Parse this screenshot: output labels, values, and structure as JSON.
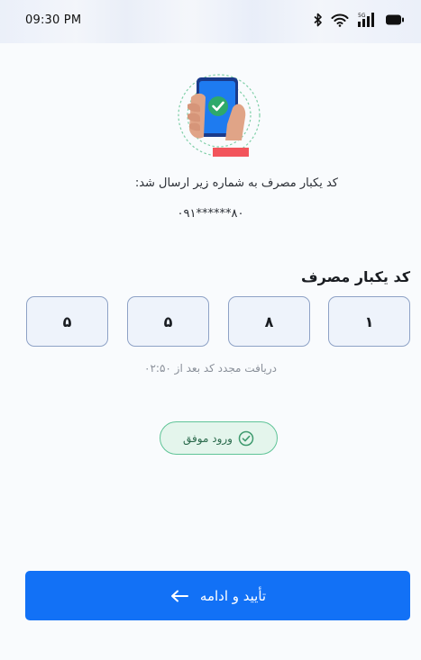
{
  "status_bar": {
    "time": "09:30 PM",
    "network_label": "5G"
  },
  "hero": {
    "icon": "phone-check-illustration"
  },
  "message": {
    "sent_text": "کد یکبار مصرف به شماره زیر ارسال شد:",
    "phone_number": "۰۹۱******۸۰"
  },
  "otp": {
    "title": "کد یکبار مصرف",
    "digits": [
      "۱",
      "۸",
      "۵",
      "۵"
    ]
  },
  "resend": {
    "text": "دریافت مجدد کد بعد از  ۰۲:۵۰"
  },
  "success": {
    "label": "ورود موفق",
    "icon": "check-circle-icon"
  },
  "submit": {
    "label": "تأیید و ادامه",
    "icon": "arrow-left-icon"
  },
  "colors": {
    "primary": "#1271f6",
    "success": "#5fc497",
    "otp_border": "#8ea2c6"
  }
}
